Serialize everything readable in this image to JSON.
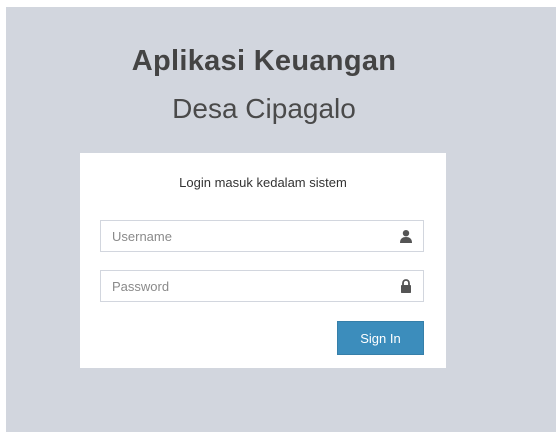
{
  "app": {
    "title": "Aplikasi Keuangan",
    "subtitle": "Desa Cipagalo"
  },
  "login": {
    "message": "Login masuk kedalam sistem",
    "username": {
      "placeholder": "Username",
      "value": "",
      "icon": "user-icon"
    },
    "password": {
      "placeholder": "Password",
      "value": "",
      "icon": "lock-icon"
    },
    "submit_label": "Sign In"
  },
  "colors": {
    "background": "#d2d6de",
    "box": "#ffffff",
    "primary_button": "#3c8dbc",
    "text": "#444444"
  }
}
